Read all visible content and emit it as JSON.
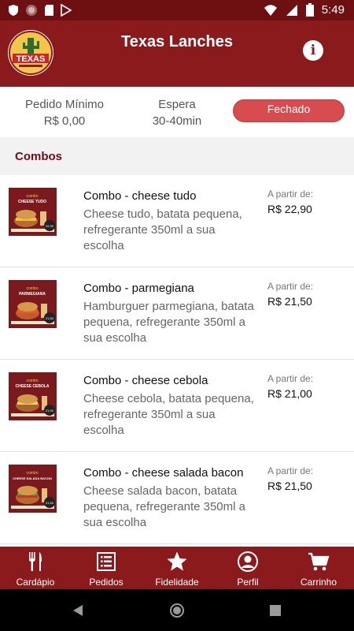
{
  "status_bar": {
    "time": "5:49",
    "left_icons": [
      "shield-icon",
      "circle-icon",
      "sd-card-icon",
      "play-store-icon"
    ],
    "right_icons": [
      "wifi-icon",
      "signal-icon",
      "battery-icon"
    ]
  },
  "app_bar": {
    "title": "Texas Lanches",
    "logo_text": "TEXAS",
    "info_icon": "i"
  },
  "info": {
    "min_order_label": "Pedido Mínimo",
    "min_order_value": "R$ 0,00",
    "wait_label": "Espera",
    "wait_value": "30-40min",
    "status": "Fechado"
  },
  "section": {
    "title": "Combos"
  },
  "items": [
    {
      "name": "Combo - cheese tudo",
      "description": "Cheese tudo, batata pequena, refregerante 350ml a sua escolha",
      "price_caption": "A partir de:",
      "price": "R$ 22,90",
      "thumb_caption": "CHEESE TUDO",
      "thumb_price": "22,90"
    },
    {
      "name": "Combo - parmegiana",
      "description": "Hamburguer parmegiana, batata pequena, refregerante 350ml a sua escolha",
      "price_caption": "A partir de:",
      "price": "R$ 21,50",
      "thumb_caption": "PARMEGIANA",
      "thumb_price": "21,50"
    },
    {
      "name": "Combo - cheese cebola",
      "description": "Cheese cebola, batata pequena, refregerante 350ml a sua escolha",
      "price_caption": "A partir de:",
      "price": "R$ 21,00",
      "thumb_caption": "CHEESE CEBOLA",
      "thumb_price": "21,00"
    },
    {
      "name": "Combo - cheese salada bacon",
      "description": "Cheese salada bacon, batata pequena, refregerante 350ml a sua escolha",
      "price_caption": "A partir de:",
      "price": "R$ 21,50",
      "thumb_caption": "CHEESE SALADA BACON",
      "thumb_price": "21,50"
    }
  ],
  "bottom_nav": [
    {
      "label": "Cardápio",
      "icon": "fork-knife-icon"
    },
    {
      "label": "Pedidos",
      "icon": "list-icon"
    },
    {
      "label": "Fidelidade",
      "icon": "star-icon"
    },
    {
      "label": "Perfil",
      "icon": "person-icon"
    },
    {
      "label": "Carrinho",
      "icon": "cart-icon"
    }
  ],
  "colors": {
    "primary": "#8b1a1d",
    "status_bar": "#6e0f12",
    "closed_badge": "#d64c4f",
    "section_bg": "#f2f2f2"
  }
}
